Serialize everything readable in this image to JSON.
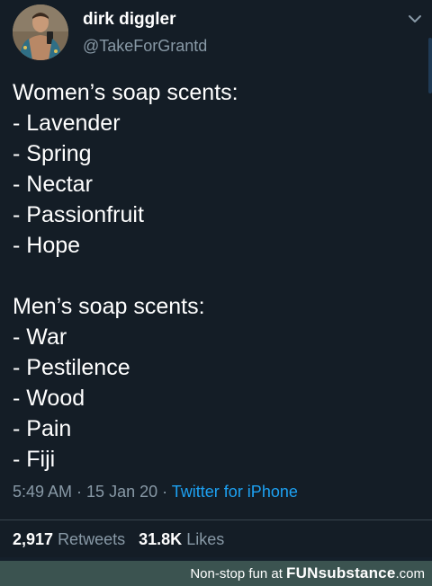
{
  "header": {
    "display_name": "dirk diggler",
    "handle": "@TakeForGrantd"
  },
  "tweet": {
    "lines": [
      "Women’s soap scents:",
      "- Lavender",
      "- Spring",
      "- Nectar",
      "- Passionfruit",
      "- Hope",
      "",
      "Men’s soap scents:",
      "- War",
      "- Pestilence",
      "- Wood",
      "- Pain",
      "- Fiji"
    ]
  },
  "meta": {
    "time": "5:49 AM",
    "separator": " · ",
    "date": "15 Jan 20",
    "source": "Twitter for iPhone"
  },
  "stats": {
    "retweets_count": "2,917",
    "retweets_label": "Retweets",
    "likes_count": "31.8K",
    "likes_label": "Likes"
  },
  "watermark": {
    "prefix": "Non-stop fun at",
    "brand": "FUNsubstance",
    "suffix": ".com"
  },
  "colors": {
    "background": "#141d26",
    "secondary_text": "#8899a6",
    "link": "#1da1f2",
    "watermark_bar": "#3b5350"
  },
  "icons": {
    "menu": "chevron-down-icon"
  }
}
